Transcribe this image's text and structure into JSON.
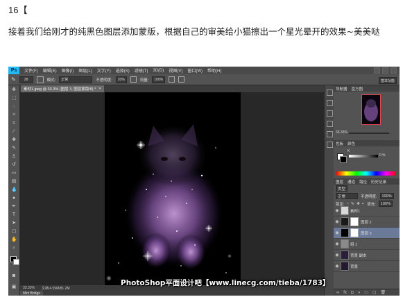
{
  "article": {
    "step_label": "16【",
    "description": "接着我们给刚才的纯黑色图层添加蒙版，根据自己的审美给小猫擦出一个星光晕开的效果~美美哒"
  },
  "ps": {
    "logo": "Ps",
    "menu": [
      "文件(F)",
      "编辑(E)",
      "图像(I)",
      "图层(L)",
      "文字(Y)",
      "选择(S)",
      "滤镜(T)",
      "3D(D)",
      "视图(V)",
      "窗口(W)",
      "帮助(H)"
    ],
    "options": {
      "brush_size": "28",
      "mode_label": "模式:",
      "mode_value": "正常",
      "opacity_label": "不透明度:",
      "opacity_value": "20%",
      "flow_label": "流量:",
      "flow_value": "100%",
      "workspace": "基本功能"
    },
    "doc_tab": "素材1.jpeg @ 33.3% (图层 3, 图层蒙版/8) *",
    "doc_tab_close": "×",
    "status": {
      "zoom": "33.33%",
      "doc_info": "文档:4.59M/81.2M"
    },
    "minibridge": "Mini Bridge",
    "navigator": {
      "tabs": [
        "导航器",
        "直方图"
      ],
      "zoom": "33.33%"
    },
    "color_panel": {
      "tabs": [
        "色板",
        "颜色"
      ],
      "channel": "K",
      "value": "0",
      "unit": "%"
    },
    "layers_panel": {
      "tabs": [
        "图层",
        "通道",
        "路径",
        "历史记录"
      ],
      "kind_label": "类型",
      "blend_mode": "正常",
      "opacity_label": "不透明度:",
      "opacity": "100%",
      "lock_label": "锁定:",
      "fill_label": "填充:",
      "fill": "100%",
      "layers": [
        {
          "name": "素材1",
          "thumb": "#d8d8d8",
          "selected": false,
          "has_mask": false
        },
        {
          "name": "图层 2",
          "thumb": "#1a1a1a",
          "selected": false,
          "has_mask": true
        },
        {
          "name": "图层 3",
          "thumb": "#000000",
          "selected": true,
          "has_mask": true
        },
        {
          "name": "组 1",
          "thumb": "#8a8a8a",
          "selected": false,
          "has_mask": false
        },
        {
          "name": "背景 副本",
          "thumb": "#2a1e38",
          "selected": false,
          "has_mask": false
        },
        {
          "name": "背景",
          "thumb": "#241a30",
          "selected": false,
          "has_mask": false
        }
      ]
    }
  },
  "watermark": "PhotoShop平面设计吧【www.linecg.com/tieba/1783】",
  "colors": {
    "ps_blue": "#25b7f1",
    "selected_layer": "#6b7a99",
    "nav_frame": "#e0484e"
  }
}
